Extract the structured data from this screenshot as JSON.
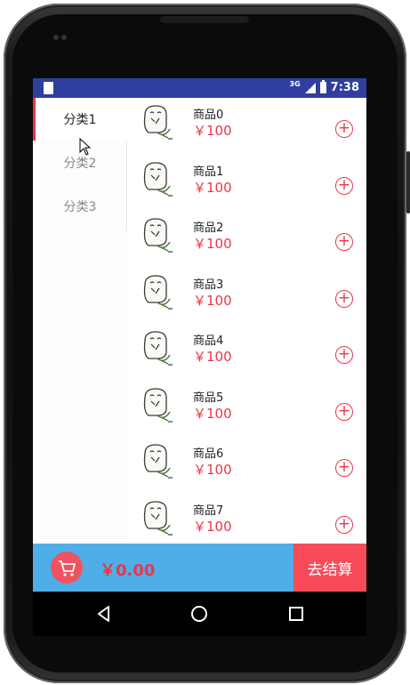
{
  "status_bar": {
    "network": "3G",
    "time": "7:38"
  },
  "categories": [
    {
      "label": "分类1",
      "active": true
    },
    {
      "label": "分类2",
      "active": false
    },
    {
      "label": "分类3",
      "active": false
    }
  ],
  "goods": [
    {
      "name": "商品0",
      "price": "￥100"
    },
    {
      "name": "商品1",
      "price": "￥100"
    },
    {
      "name": "商品2",
      "price": "￥100"
    },
    {
      "name": "商品3",
      "price": "￥100"
    },
    {
      "name": "商品4",
      "price": "￥100"
    },
    {
      "name": "商品5",
      "price": "￥100"
    },
    {
      "name": "商品6",
      "price": "￥100"
    },
    {
      "name": "商品7",
      "price": "￥100"
    }
  ],
  "cart": {
    "total": "￥0.00",
    "checkout_label": "去结算"
  },
  "colors": {
    "status_bar": "#303F9F",
    "accent_red": "#E8364B",
    "bottom_bar": "#4FAEE7",
    "checkout_bg": "#F74B5A"
  },
  "icons": {
    "add": "plus-circle-icon",
    "cart": "cart-icon",
    "back": "triangle-back-icon",
    "home": "circle-home-icon",
    "recents": "square-recents-icon"
  }
}
